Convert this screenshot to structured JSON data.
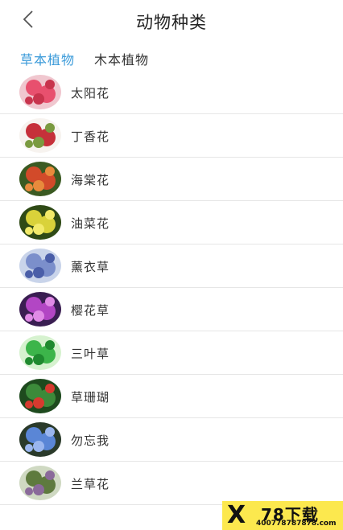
{
  "header": {
    "title": "动物种类",
    "back_icon": "chevron-left-icon"
  },
  "tabs": [
    {
      "label": "草本植物",
      "active": true
    },
    {
      "label": "木本植物",
      "active": false
    }
  ],
  "accent_color": "#3a9ad9",
  "items": [
    {
      "label": "太阳花",
      "colors": [
        "#f0c7cf",
        "#e8506e",
        "#c8344d"
      ]
    },
    {
      "label": "丁香花",
      "colors": [
        "#f7f3ef",
        "#c6303a",
        "#7a9a40"
      ]
    },
    {
      "label": "海棠花",
      "colors": [
        "#3b5a22",
        "#d24a2a",
        "#e88a3c"
      ]
    },
    {
      "label": "油菜花",
      "colors": [
        "#2f4a16",
        "#d9d23a",
        "#f2ea6a"
      ]
    },
    {
      "label": "薰衣草",
      "colors": [
        "#c9d4ea",
        "#7b8fcb",
        "#4a5ea8"
      ]
    },
    {
      "label": "樱花草",
      "colors": [
        "#3a1e52",
        "#b246c4",
        "#e08ae6"
      ]
    },
    {
      "label": "三叶草",
      "colors": [
        "#d6f2cf",
        "#3cb54a",
        "#1f8a2f"
      ]
    },
    {
      "label": "草珊瑚",
      "colors": [
        "#1e4a1e",
        "#3c8a3a",
        "#d63a2f"
      ]
    },
    {
      "label": "勿忘我",
      "colors": [
        "#2a3a2a",
        "#5a86d6",
        "#9ab6ee"
      ]
    },
    {
      "label": "兰草花",
      "colors": [
        "#cfd9c2",
        "#5e7a3e",
        "#8a6a9a"
      ]
    }
  ],
  "watermark": {
    "brand": "78下载",
    "url": "400778787878.com"
  }
}
